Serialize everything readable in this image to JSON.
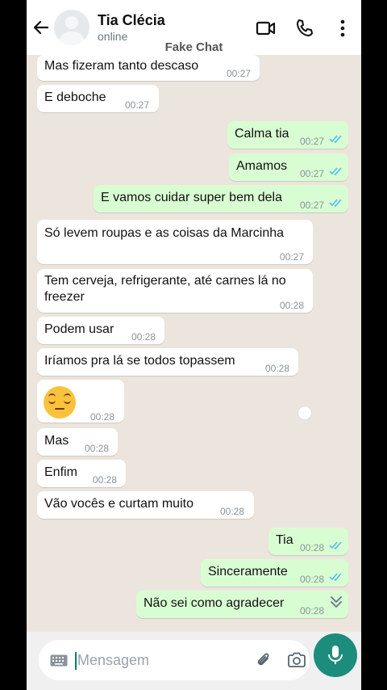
{
  "header": {
    "contact_name": "Tia Clécia",
    "status": "online",
    "watermark": "Fake Chat"
  },
  "messages": [
    {
      "dir": "in",
      "text": "Mas fizeram tanto descaso",
      "time": "00:27"
    },
    {
      "dir": "in",
      "text": "E deboche",
      "time": "00:27"
    },
    {
      "dir": "out",
      "text": "Calma tia",
      "time": "00:27",
      "read": true
    },
    {
      "dir": "out",
      "text": "Amamos",
      "time": "00:27",
      "read": true
    },
    {
      "dir": "out",
      "text": "E vamos cuidar super bem dela",
      "time": "00:27",
      "read": true
    },
    {
      "dir": "in",
      "text": "Só levem roupas e as coisas da Marcinha",
      "time": "00:27"
    },
    {
      "dir": "in",
      "text_line1": "Tem cerveja, refrigerante, até carnes lá no",
      "text_line2": "freezer",
      "time": "00:28"
    },
    {
      "dir": "in",
      "text": "Podem usar",
      "time": "00:28"
    },
    {
      "dir": "in",
      "text": "Iríamos pra lá se todos topassem",
      "time": "00:28"
    },
    {
      "dir": "in",
      "emoji": "relieved-face",
      "time": "00:28"
    },
    {
      "dir": "in",
      "text": "Mas",
      "time": "00:28"
    },
    {
      "dir": "in",
      "text": "Enfim",
      "time": "00:28"
    },
    {
      "dir": "in",
      "text": "Vão vocês e curtam muito",
      "time": "00:28"
    },
    {
      "dir": "out",
      "text": "Tia",
      "time": "00:28",
      "read": true
    },
    {
      "dir": "out",
      "text": "Sinceramente",
      "time": "00:28",
      "read": true
    },
    {
      "dir": "out",
      "text": "Não sei como agradecer",
      "time": "00:28",
      "read": true
    }
  ],
  "composer": {
    "placeholder": "Mensagem"
  },
  "colors": {
    "wallpaper": "#ece5dd",
    "outgoing_bubble": "#d9fdd3",
    "incoming_bubble": "#ffffff",
    "accent": "#1c8c7d",
    "read_ticks": "#53bdeb"
  }
}
